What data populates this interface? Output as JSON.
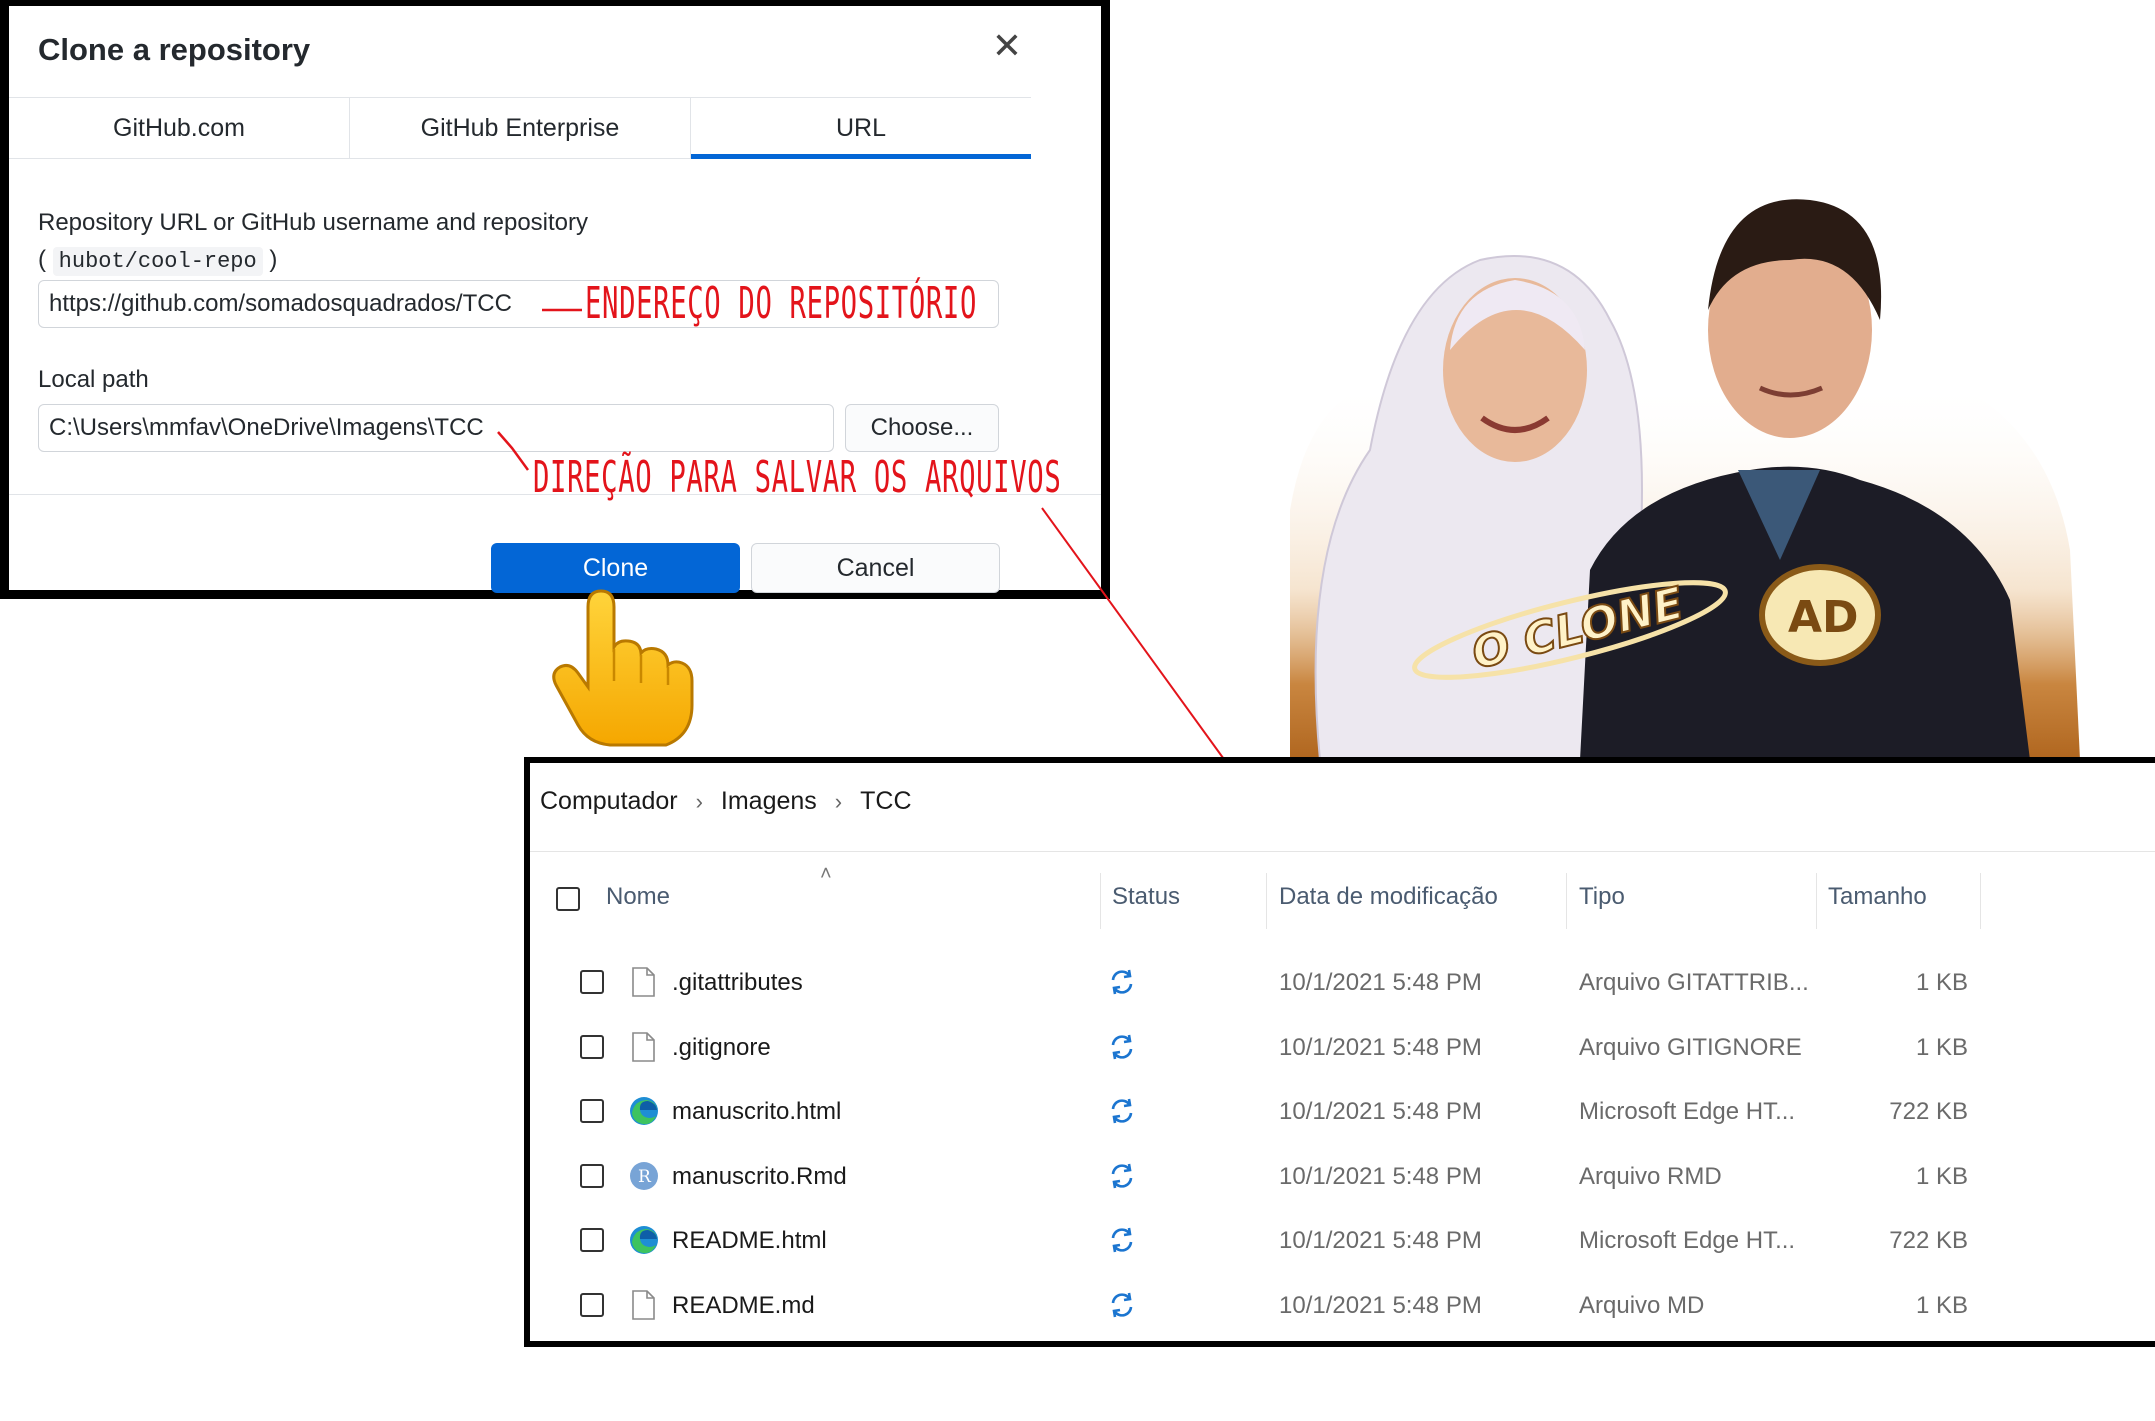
{
  "dialog": {
    "title": "Clone a repository",
    "tabs": [
      "GitHub.com",
      "GitHub Enterprise",
      "URL"
    ],
    "active_tab": "URL",
    "repo_label": "Repository URL or GitHub username and repository",
    "repo_hint_open": "(",
    "repo_hint_code": "hubot/cool-repo",
    "repo_hint_close": ")",
    "repo_value": "https://github.com/somadosquadrados/TCC",
    "local_label": "Local path",
    "local_value": "C:\\Users\\mmfav\\OneDrive\\Imagens\\TCC",
    "choose_label": "Choose...",
    "clone_label": "Clone",
    "cancel_label": "Cancel",
    "accent_color": "#0366d6"
  },
  "annotations": {
    "repo": "ENDEREÇO DO REPOSITÓRIO",
    "path": "DIREÇÃO PARA SALVAR OS ARQUIVOS",
    "color": "#e3141b"
  },
  "poster": {
    "logo_text": "O CLONE",
    "badge_text": "AD"
  },
  "explorer": {
    "breadcrumb": [
      "Computador",
      "Imagens",
      "TCC"
    ],
    "columns": [
      "Nome",
      "Status",
      "Data de modificação",
      "Tipo",
      "Tamanho"
    ],
    "files": [
      {
        "name": ".gitattributes",
        "icon": "blank-file-icon",
        "date": "10/1/2021 5:48 PM",
        "type": "Arquivo GITATTRIB...",
        "size": "1 KB"
      },
      {
        "name": ".gitignore",
        "icon": "blank-file-icon",
        "date": "10/1/2021 5:48 PM",
        "type": "Arquivo GITIGNORE",
        "size": "1 KB"
      },
      {
        "name": "manuscrito.html",
        "icon": "edge-icon",
        "date": "10/1/2021 5:48 PM",
        "type": "Microsoft Edge HT...",
        "size": "722 KB"
      },
      {
        "name": "manuscrito.Rmd",
        "icon": "r-file-icon",
        "date": "10/1/2021 5:48 PM",
        "type": "Arquivo RMD",
        "size": "1 KB"
      },
      {
        "name": "README.html",
        "icon": "edge-icon",
        "date": "10/1/2021 5:48 PM",
        "type": "Microsoft Edge HT...",
        "size": "722 KB"
      },
      {
        "name": "README.md",
        "icon": "blank-file-icon",
        "date": "10/1/2021 5:48 PM",
        "type": "Arquivo MD",
        "size": "1 KB"
      }
    ]
  }
}
